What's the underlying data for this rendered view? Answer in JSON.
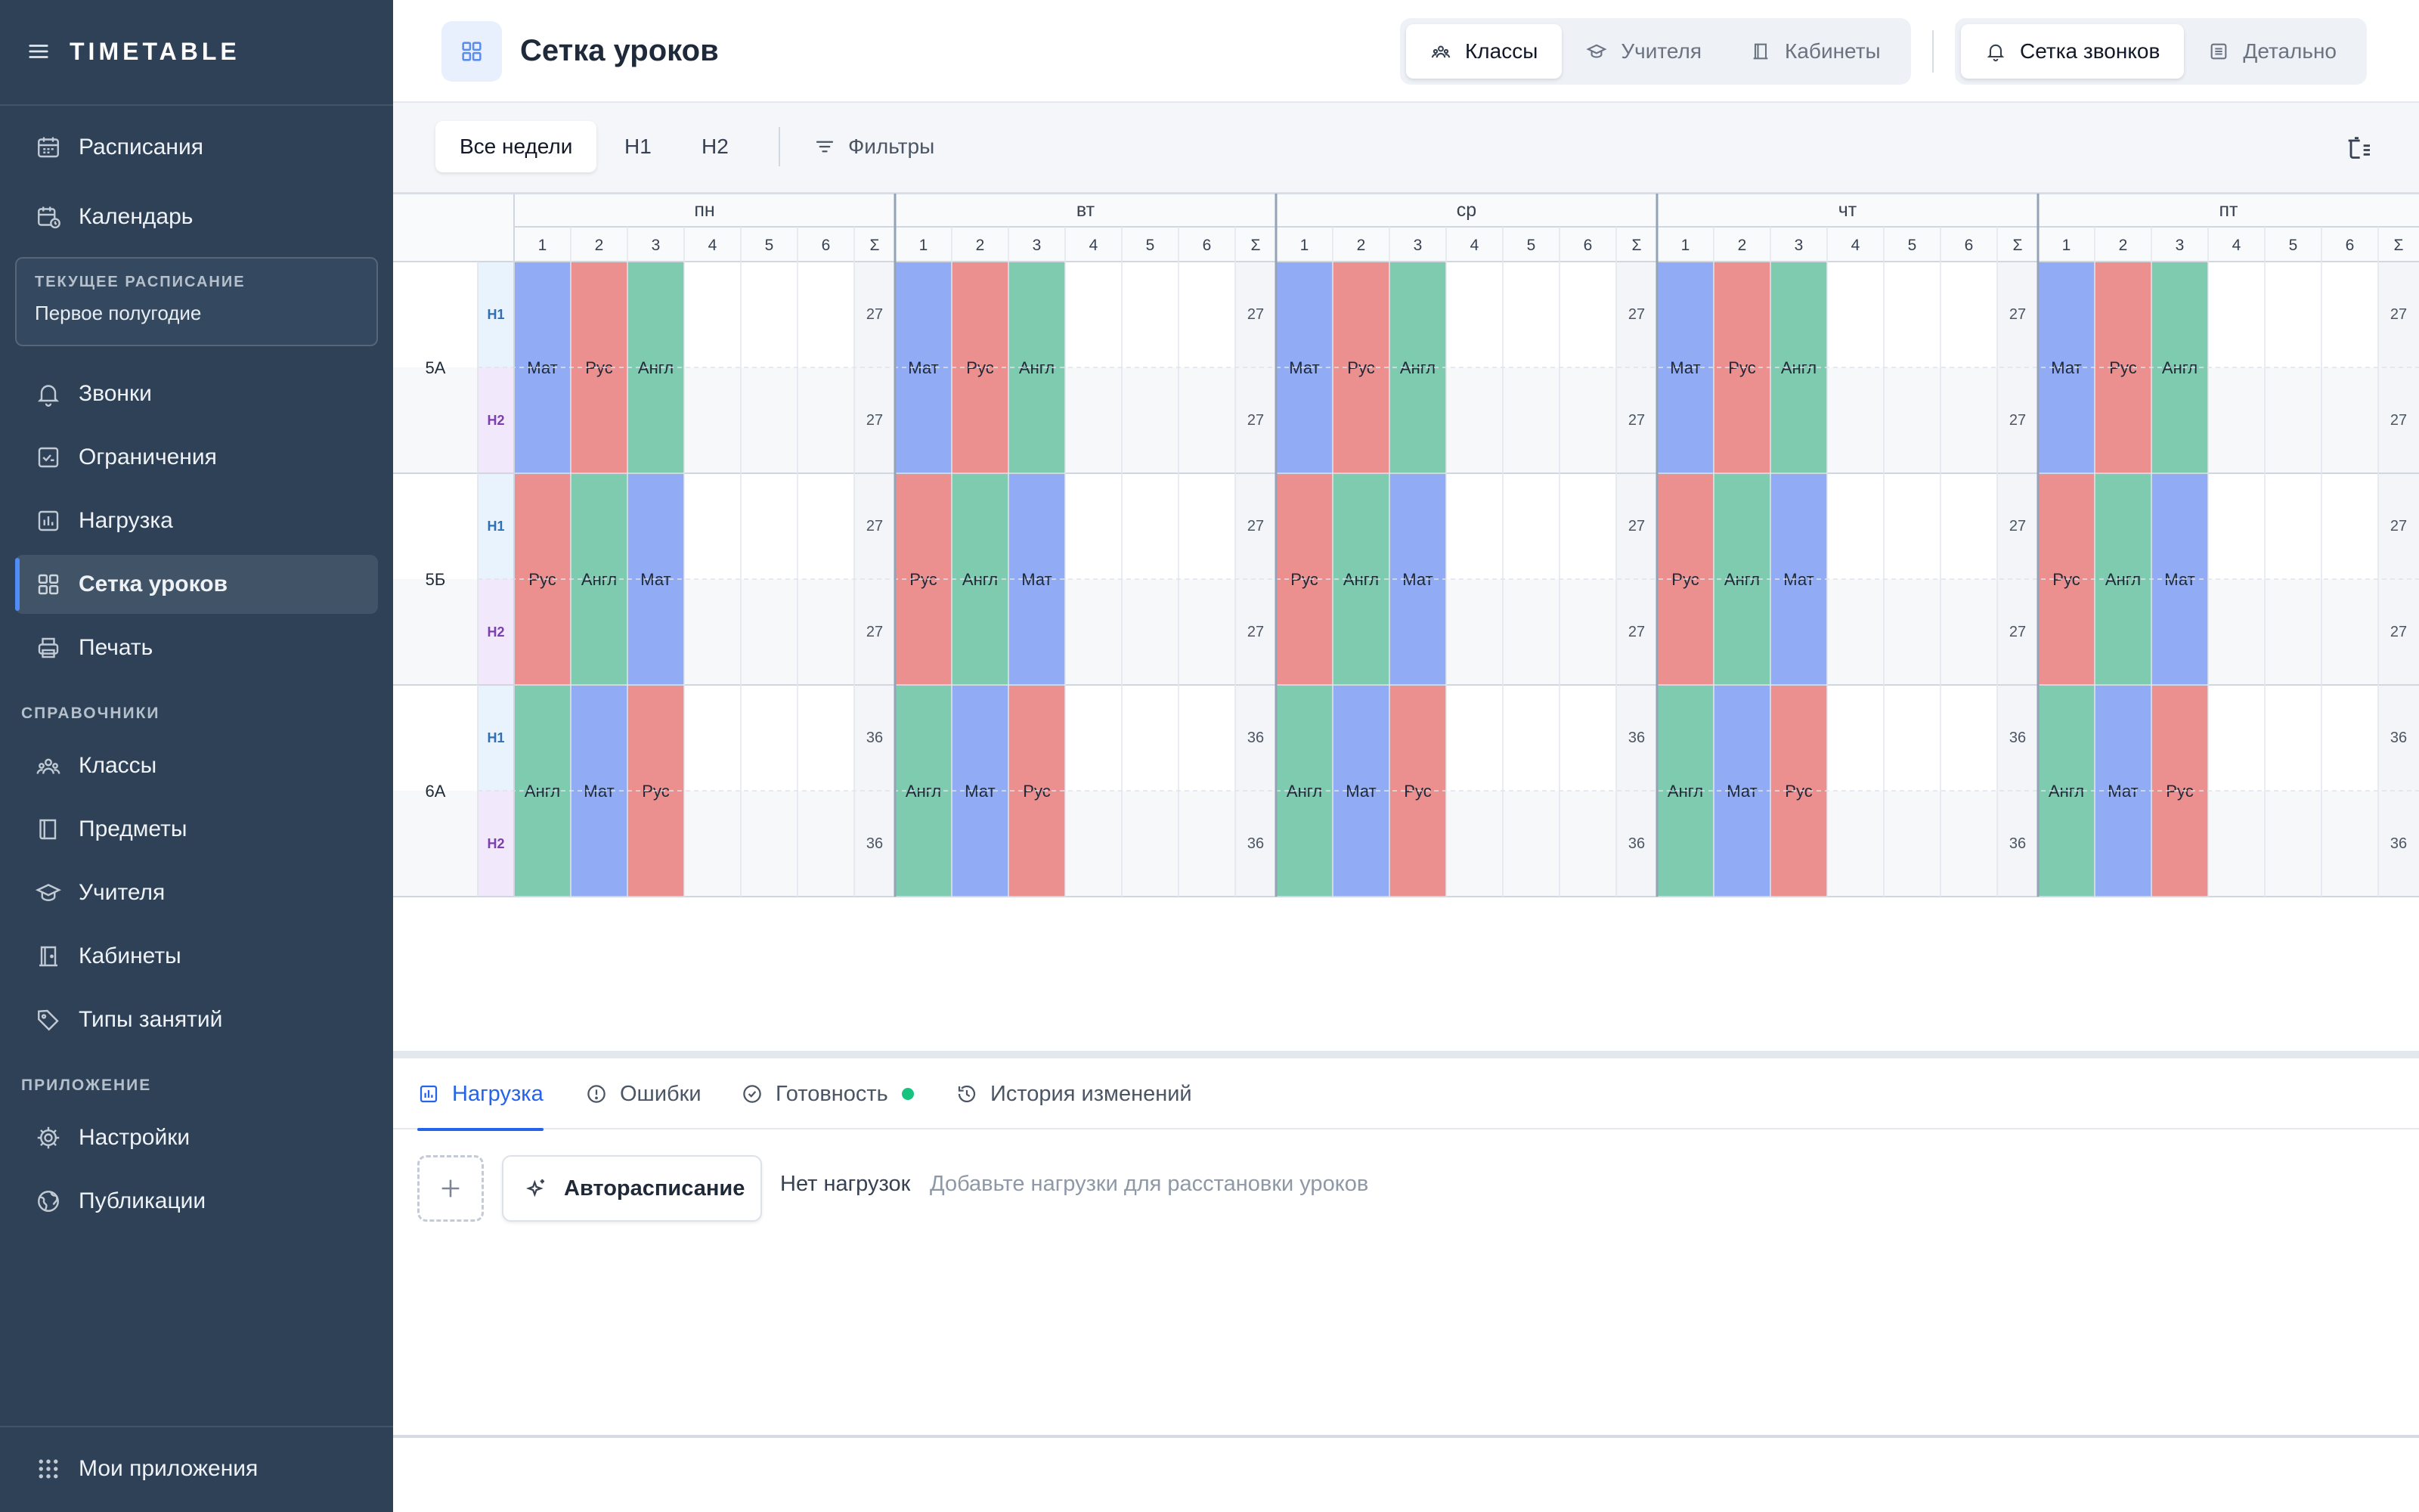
{
  "brand": "TIMETABLE",
  "sidebar": {
    "nav_top": [
      {
        "label": "Расписания",
        "icon": "calendar-icon"
      },
      {
        "label": "Календарь",
        "icon": "calendar-clock-icon"
      }
    ],
    "current": {
      "label": "ТЕКУЩЕЕ РАСПИСАНИЕ",
      "value": "Первое полугодие"
    },
    "nav_main": [
      {
        "label": "Звонки",
        "icon": "bell-icon"
      },
      {
        "label": "Ограничения",
        "icon": "constraint-icon"
      },
      {
        "label": "Нагрузка",
        "icon": "chart-icon"
      },
      {
        "label": "Сетка уроков",
        "icon": "grid-icon",
        "active": true
      },
      {
        "label": "Печать",
        "icon": "printer-icon"
      }
    ],
    "section_refs": "СПРАВОЧНИКИ",
    "nav_refs": [
      {
        "label": "Классы",
        "icon": "users-icon"
      },
      {
        "label": "Предметы",
        "icon": "book-icon"
      },
      {
        "label": "Учителя",
        "icon": "graduation-cap-icon"
      },
      {
        "label": "Кабинеты",
        "icon": "door-icon"
      },
      {
        "label": "Типы занятий",
        "icon": "tag-icon"
      }
    ],
    "section_app": "ПРИЛОЖЕНИЕ",
    "nav_app": [
      {
        "label": "Настройки",
        "icon": "gear-icon"
      },
      {
        "label": "Публикации",
        "icon": "globe-icon"
      }
    ],
    "my_apps": "Мои приложения"
  },
  "header": {
    "title": "Сетка уроков",
    "view_tabs": [
      "Классы",
      "Учителя",
      "Кабинеты"
    ],
    "mode_tabs": [
      "Сетка звонков",
      "Детально"
    ]
  },
  "toolbar": {
    "weeks": [
      "Все недели",
      "Н1",
      "Н2"
    ],
    "filters": "Фильтры"
  },
  "grid": {
    "days": [
      "пн",
      "вт",
      "ср",
      "чт",
      "пт"
    ],
    "periods": [
      "1",
      "2",
      "3",
      "4",
      "5",
      "6"
    ],
    "sum_label": "Σ",
    "week_labels": [
      "Н1",
      "Н2"
    ],
    "rows": [
      {
        "cls": "5А",
        "lessons": [
          "Мат",
          "Рус",
          "Англ"
        ],
        "sum": "27"
      },
      {
        "cls": "5Б",
        "lessons": [
          "Рус",
          "Англ",
          "Мат"
        ],
        "sum": "27"
      },
      {
        "cls": "6А",
        "lessons": [
          "Англ",
          "Мат",
          "Рус"
        ],
        "sum": "36"
      }
    ],
    "subject_colors": {
      "Мат": "#91acf5",
      "Рус": "#eb8f8f",
      "Англ": "#7fcbb0"
    }
  },
  "panel": {
    "tabs": [
      "Нагрузка",
      "Ошибки",
      "Готовность",
      "История изменений"
    ],
    "auto_label": "Авторасписание",
    "empty_title": "Нет нагрузок",
    "empty_hint": "Добавьте нагрузки для расстановки уроков"
  }
}
